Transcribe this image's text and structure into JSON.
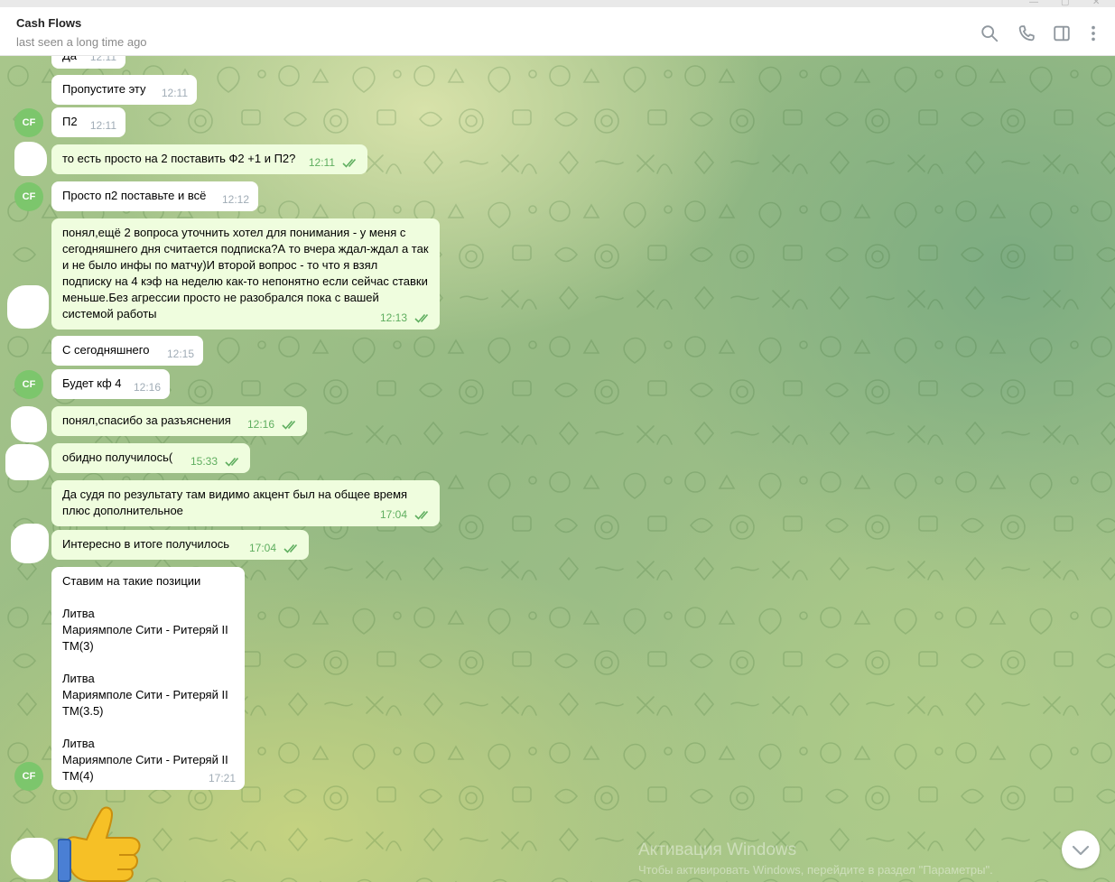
{
  "header": {
    "title": "Cash Flows",
    "status": "last seen a long time ago",
    "icons": [
      "search-icon",
      "phone-icon",
      "sidebar-toggle-icon",
      "more-vertical-icon"
    ]
  },
  "messages": [
    {
      "dir": "in",
      "text": "Да",
      "time": "12:11"
    },
    {
      "dir": "in",
      "text": "Пропустите эту",
      "time": "12:11"
    },
    {
      "dir": "in",
      "text": "П2",
      "time": "12:11",
      "avatar": "CF"
    },
    {
      "dir": "out",
      "text": "то есть просто на 2 поставить Ф2 +1 и П2?",
      "time": "12:11",
      "read": true
    },
    {
      "dir": "in",
      "text": "Просто п2 поставьте и всё",
      "time": "12:12",
      "avatar": "CF"
    },
    {
      "dir": "out",
      "text": "понял,ещё 2 вопроса уточнить хотел для понимания - у меня с сегодняшнего дня считается подписка?А то вчера ждал-ждал а так и не было инфы по матчу)И второй вопрос - то что я взял подписку на 4 кэф на неделю как-то непонятно если сейчас ставки меньше.Без агрессии просто не разобрался пока с вашей системой работы",
      "time": "12:13",
      "read": true
    },
    {
      "dir": "in",
      "text": "С сегодняшнего",
      "time": "12:15"
    },
    {
      "dir": "in",
      "text": "Будет кф 4",
      "time": "12:16",
      "avatar": "CF"
    },
    {
      "dir": "out",
      "text": "понял,спасибо за разъяснения",
      "time": "12:16",
      "read": true
    },
    {
      "dir": "out",
      "text": "обидно получилось(",
      "time": "15:33",
      "read": true
    },
    {
      "dir": "out",
      "text": "Да судя по результату там видимо акцент был на общее время плюс дополнительное",
      "time": "17:04",
      "read": true
    },
    {
      "dir": "out",
      "text": "Интересно в итоге получилось",
      "time": "17:04",
      "read": true
    },
    {
      "dir": "in",
      "text": "Ставим на такие позиции\n\nЛитва\nМариямполе Сити - Ритеряй II\nТМ(3)\n\nЛитва\nМариямполе Сити - Ритеряй II\nТМ(3.5)\n\nЛитва\nМариямполе Сити - Ритеряй II\nТМ(4)",
      "time": "17:21",
      "avatar": "CF"
    },
    {
      "dir": "out",
      "sticker": "thumbs-up-emoji"
    }
  ],
  "watermark": {
    "line1": "Активация Windows",
    "line2": "Чтобы активировать Windows, перейдите в раздел \"Параметры\"."
  },
  "colors": {
    "incoming_bubble": "#ffffff",
    "outgoing_bubble": "#effdde",
    "read_check": "#5fae5f",
    "avatar": "#7cc66c"
  }
}
